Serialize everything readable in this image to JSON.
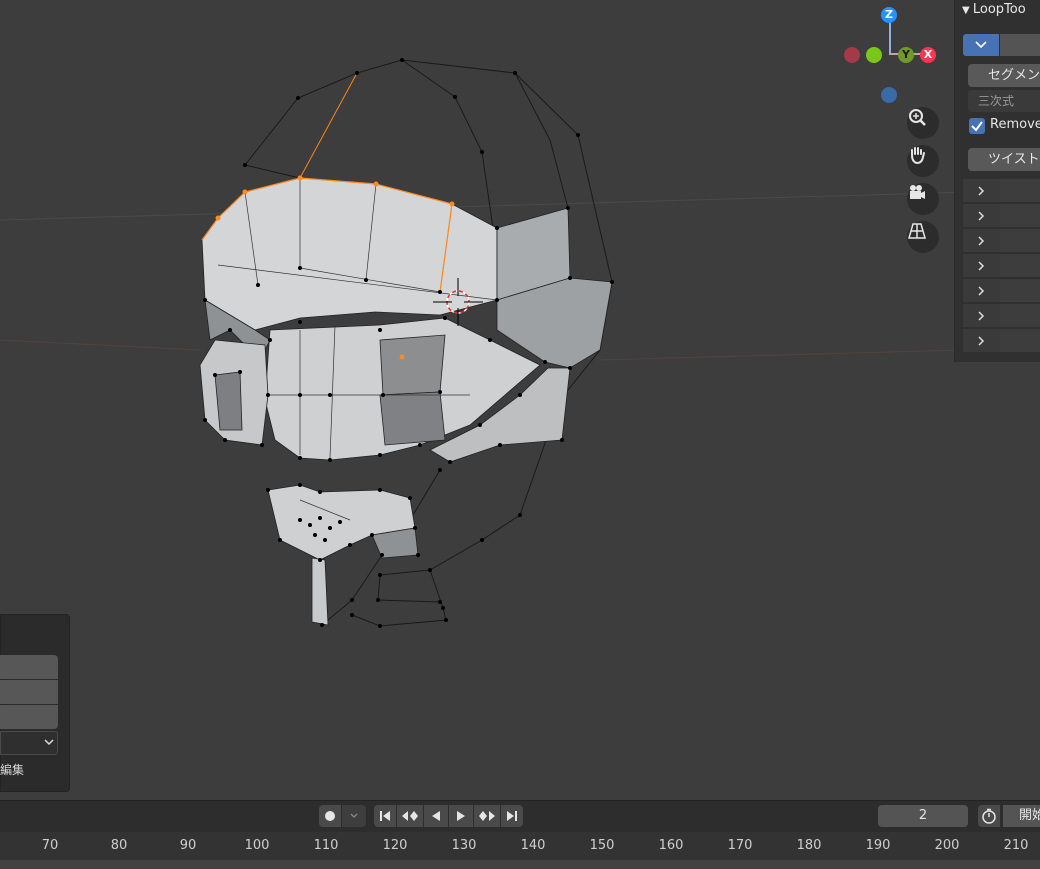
{
  "gizmo": {
    "z": "Z",
    "y": "Y",
    "x": "X"
  },
  "nav_buttons": [
    "zoom-icon",
    "hand-pan-icon",
    "camera-icon",
    "grid-perspective-icon"
  ],
  "sidebar": {
    "header": "LoopToo",
    "segment_button": "セグメン",
    "interpolation_field": "三次式",
    "remove_checkbox_label": "Remove",
    "remove_checked": true,
    "twist_button": "ツイスト",
    "collapsed_rows": 7
  },
  "operator_panel": {
    "edit_label": "編集"
  },
  "timeline": {
    "current_frame": "2",
    "start_label": "開始",
    "ruler_ticks": [
      "70",
      "80",
      "90",
      "100",
      "110",
      "120",
      "130",
      "140",
      "150",
      "160",
      "170",
      "180",
      "190",
      "200",
      "210"
    ]
  },
  "colors": {
    "accent": "#4772b3",
    "x_axis": "#ff3352",
    "y_axis": "#8bdc00",
    "z_axis": "#2890ff",
    "selection": "#ff8a1e"
  }
}
